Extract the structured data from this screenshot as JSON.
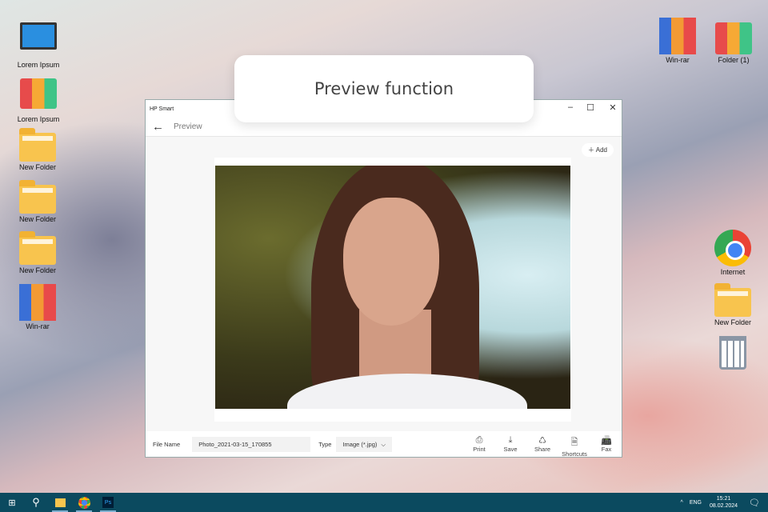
{
  "callout": "Preview function",
  "desktop_left": [
    {
      "label": "Lorem Ipsum",
      "icon": "computer-icon"
    },
    {
      "label": "Lorem Ipsum",
      "icon": "binders-icon"
    },
    {
      "label": "New Folder",
      "icon": "folder-icon"
    },
    {
      "label": "New Folder",
      "icon": "folder-icon"
    },
    {
      "label": "New Folder",
      "icon": "folder-icon"
    },
    {
      "label": "Win-rar",
      "icon": "winrar-icon"
    }
  ],
  "desktop_right": [
    {
      "label": "Win-rar",
      "icon": "winrar-icon"
    },
    {
      "label": "Folder (1)",
      "icon": "binders-icon"
    },
    {
      "label": "Internet",
      "icon": "chrome-icon"
    },
    {
      "label": "New Folder",
      "icon": "folder-icon"
    }
  ],
  "window": {
    "title": "HP Smart",
    "page": "Preview",
    "add": "Add",
    "file_name_label": "File Name",
    "file_name": "Photo_2021-03-15_170855",
    "type_label": "Type",
    "type_value": "Image (*.jpg)",
    "actions": [
      "Print",
      "Save",
      "Share",
      "Shortcuts",
      "Fax"
    ]
  },
  "taskbar": {
    "lang": "ENG",
    "time": "15:21",
    "date": "08.02.2024"
  }
}
